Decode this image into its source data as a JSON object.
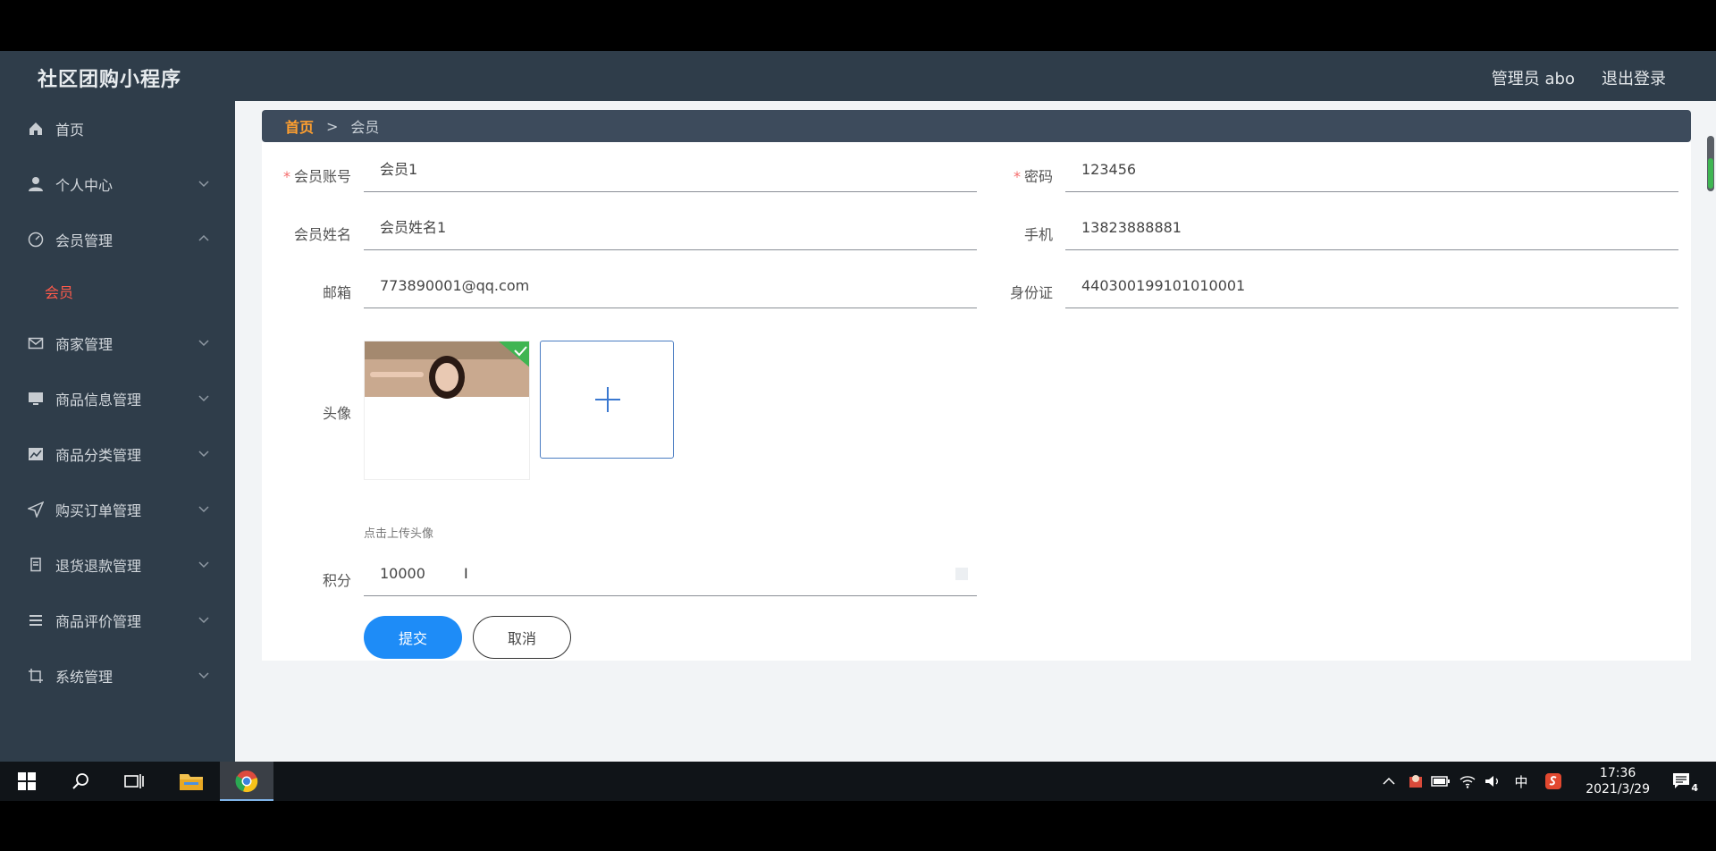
{
  "header": {
    "app_title": "社区团购小程序",
    "admin_label": "管理员 abo",
    "logout_label": "退出登录"
  },
  "sidebar": {
    "items": [
      {
        "label": "首页",
        "icon": "home-icon",
        "expanded": null
      },
      {
        "label": "个人中心",
        "icon": "user-icon",
        "expanded": false
      },
      {
        "label": "会员管理",
        "icon": "dashboard-icon",
        "expanded": true
      },
      {
        "label": "商家管理",
        "icon": "mail-icon",
        "expanded": false
      },
      {
        "label": "商品信息管理",
        "icon": "monitor-icon",
        "expanded": false
      },
      {
        "label": "商品分类管理",
        "icon": "chart-icon",
        "expanded": false
      },
      {
        "label": "购买订单管理",
        "icon": "send-icon",
        "expanded": false
      },
      {
        "label": "退货退款管理",
        "icon": "receipt-icon",
        "expanded": false
      },
      {
        "label": "商品评价管理",
        "icon": "list-icon",
        "expanded": false
      },
      {
        "label": "系统管理",
        "icon": "crop-icon",
        "expanded": false
      }
    ],
    "active_sub_item": "会员"
  },
  "breadcrumb": {
    "home": "首页",
    "separator": ">",
    "current": "会员"
  },
  "form": {
    "account": {
      "label": "会员账号",
      "value": "会员1",
      "required": true
    },
    "password": {
      "label": "密码",
      "value": "123456",
      "required": true
    },
    "name": {
      "label": "会员姓名",
      "value": "会员姓名1"
    },
    "phone": {
      "label": "手机",
      "value": "13823888881"
    },
    "email": {
      "label": "邮箱",
      "value": "773890001@qq.com"
    },
    "id_card": {
      "label": "身份证",
      "value": "440300199101010001"
    },
    "avatar": {
      "label": "头像",
      "upload_hint": "点击上传头像"
    },
    "points": {
      "label": "积分",
      "value": "10000"
    },
    "submit_label": "提交",
    "cancel_label": "取消"
  },
  "taskbar": {
    "time": "17:36",
    "date": "2021/3/29",
    "ime": "中",
    "notification_count": "4"
  },
  "colors": {
    "header_bg": "#2f3d4a",
    "accent_orange": "#ff9f2f",
    "active_red": "#ff5a4a",
    "primary_blue": "#1e8cf7"
  }
}
